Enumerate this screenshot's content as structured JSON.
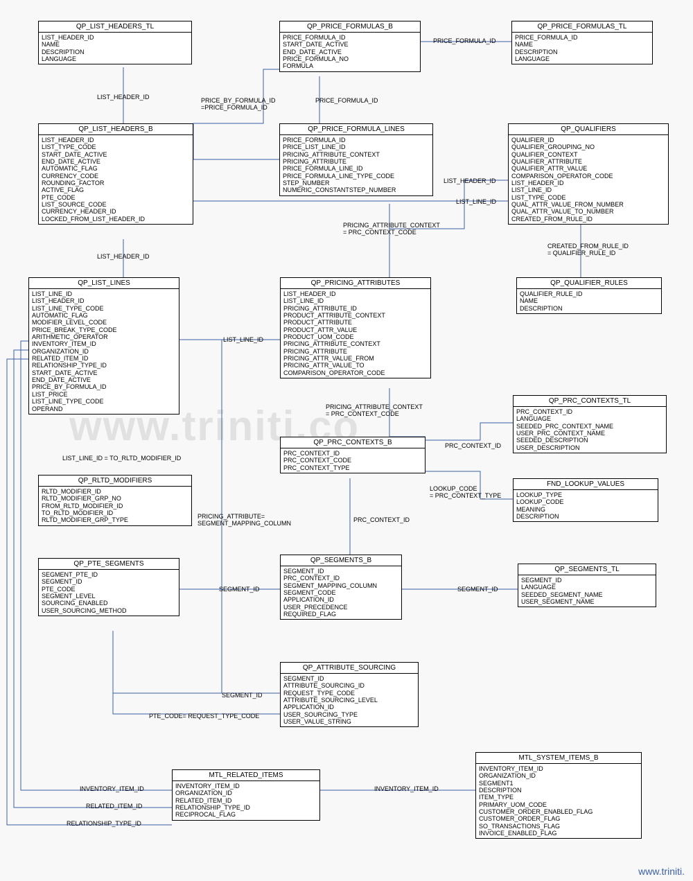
{
  "watermark": "www.triniti.co",
  "footer": "www.triniti.",
  "entities": {
    "qp_list_headers_tl": {
      "title": "QP_LIST_HEADERS_TL",
      "fields": [
        "LIST_HEADER_ID",
        "NAME",
        "DESCRIPTION",
        "LANGUAGE"
      ]
    },
    "qp_price_formulas_b": {
      "title": "QP_PRICE_FORMULAS_B",
      "fields": [
        "PRICE_FORMULA_ID",
        "START_DATE_ACTIVE",
        "END_DATE_ACTIVE",
        "PRICE_FORMULA_NO",
        "FORMULA"
      ]
    },
    "qp_price_formulas_tl": {
      "title": "QP_PRICE_FORMULAS_TL",
      "fields": [
        "PRICE_FORMULA_ID",
        "NAME",
        "DESCRIPTION",
        "LANGUAGE"
      ]
    },
    "qp_list_headers_b": {
      "title": "QP_LIST_HEADERS_B",
      "fields": [
        "LIST_HEADER_ID",
        "LIST_TYPE_CODE",
        "START_DATE_ACTIVE",
        "END_DATE_ACTIVE",
        "AUTOMATIC_FLAG",
        "CURRENCY_CODE",
        "ROUNDING_FACTOR",
        "ACTIVE_FLAG",
        "PTE_CODE",
        "LIST_SOURCE_CODE",
        "CURRENCY_HEADER_ID",
        "LOCKED_FROM_LIST_HEADER_ID"
      ]
    },
    "qp_price_formula_lines": {
      "title": "QP_PRICE_FORMULA_LINES",
      "fields": [
        "PRICE_FORMULA_ID",
        "PRICE_LIST_LINE_ID",
        "PRICING_ATTRIBUTE_CONTEXT",
        "PRICING_ATTRIBUTE",
        "PRICE_FORMULA_LINE_ID",
        "PRICE_FORMULA_LINE_TYPE_CODE",
        "STEP_NUMBER",
        "NUMERIC_CONSTANTSTEP_NUMBER"
      ]
    },
    "qp_qualifiers": {
      "title": "QP_QUALIFIERS",
      "fields": [
        "QUALIFIER_ID",
        "QUALIFIER_GROUPING_NO",
        "QUALIFIER_CONTEXT",
        "QUALIFIER_ATTRIBUTE",
        "QUALIFIER_ATTR_VALUE",
        "COMPARISON_OPERATOR_CODE",
        "LIST_HEADER_ID",
        "LIST_LINE_ID",
        "LIST_TYPE_CODE",
        "QUAL_ATTR_VALUE_FROM_NUMBER",
        "QUAL_ATTR_VALUE_TO_NUMBER",
        "CREATED_FROM_RULE_ID"
      ]
    },
    "qp_list_lines": {
      "title": "QP_LIST_LINES",
      "fields": [
        "LIST_LINE_ID",
        "LIST_HEADER_ID",
        "LIST_LINE_TYPE_CODE",
        "AUTOMATIC_FLAG",
        "MODIFIER_LEVEL_CODE",
        "PRICE_BREAK_TYPE_CODE",
        "ARITHMETIC_OPERATOR",
        "INVENTORY_ITEM_ID",
        "ORGANIZATION_ID",
        "RELATED_ITEM_ID",
        "RELATIONSHIP_TYPE_ID",
        "START_DATE_ACTIVE",
        "END_DATE_ACTIVE",
        "PRICE_BY_FORMULA_ID",
        "LIST_PRICE",
        "LIST_LINE_TYPE_CODE",
        "OPERAND"
      ]
    },
    "qp_pricing_attributes": {
      "title": "QP_PRICING_ATTRIBUTES",
      "fields": [
        "LIST_HEADER_ID",
        "LIST_LINE_ID",
        "PRICING_ATTRIBUTE_ID",
        "PRODUCT_ATTRIBUTE_CONTEXT",
        "PRODUCT_ATTRIBUTE",
        "PRODUCT_ATTR_VALUE",
        "PRODUCT_UOM_CODE",
        "PRICING_ATTRIBUTE_CONTEXT",
        "PRICING_ATTRIBUTE",
        "PRICING_ATTR_VALUE_FROM",
        "PRICING_ATTR_VALUE_TO",
        "COMPARISON_OPERATOR_CODE"
      ]
    },
    "qp_qualifier_rules": {
      "title": "QP_QUALIFIER_RULES",
      "fields": [
        "QUALIFIER_RULE_ID",
        "NAME",
        "DESCRIPTION"
      ]
    },
    "qp_prc_contexts_tl": {
      "title": "QP_PRC_CONTEXTS_TL",
      "fields": [
        "PRC_CONTEXT_ID",
        "LANGUAGE",
        "SEEDED_PRC_CONTEXT_NAME",
        "USER_PRC_CONTEXT_NAME",
        "SEEDED_DESCRIPTION",
        "USER_DESCRIPTION"
      ]
    },
    "qp_prc_contexts_b": {
      "title": "QP_PRC_CONTEXTS_B",
      "fields": [
        "PRC_CONTEXT_ID",
        "PRC_CONTEXT_CODE",
        "PRC_CONTEXT_TYPE"
      ]
    },
    "fnd_lookup_values": {
      "title": "FND_LOOKUP_VALUES",
      "fields": [
        "LOOKUP_TYPE",
        "LOOKUP_CODE",
        "MEANING",
        "DESCRIPTION"
      ]
    },
    "qp_rltd_modifiers": {
      "title": "QP_RLTD_MODIFIERS",
      "fields": [
        "RLTD_MODIFIER_ID",
        "RLTD_MODIFIER_GRP_NO",
        "FROM_RLTD_MODIFIER_ID",
        "TO_RLTD_MODIFIER_ID",
        "RLTD_MODIFIER_GRP_TYPE"
      ]
    },
    "qp_pte_segments": {
      "title": "QP_PTE_SEGMENTS",
      "fields": [
        "SEGMENT_PTE_ID",
        "SEGMENT_ID",
        "PTE_CODE",
        "SEGMENT_LEVEL",
        "SOURCING_ENABLED",
        "USER_SOURCING_METHOD"
      ]
    },
    "qp_segments_b": {
      "title": "QP_SEGMENTS_B",
      "fields": [
        "SEGMENT_ID",
        "PRC_CONTEXT_ID",
        "SEGMENT_MAPPING_COLUMN",
        "SEGMENT_CODE",
        "APPLICATION_ID",
        "USER_PRECEDENCE",
        "REQUIRED_FLAG"
      ]
    },
    "qp_segments_tl": {
      "title": "QP_SEGMENTS_TL",
      "fields": [
        "SEGMENT_ID",
        "LANGUAGE",
        "SEEDED_SEGMENT_NAME",
        "USER_SEGMENT_NAME"
      ]
    },
    "qp_attribute_sourcing": {
      "title": "QP_ATTRIBUTE_SOURCING",
      "fields": [
        "SEGMENT_ID",
        "ATTRIBUTE_SOURCING_ID",
        "REQUEST_TYPE_CODE",
        "ATTRIBUTE_SOURCING_LEVEL",
        "APPLICATION_ID",
        "USER_SOURCING_TYPE",
        "USER_VALUE_STRING"
      ]
    },
    "mtl_related_items": {
      "title": "MTL_RELATED_ITEMS",
      "fields": [
        "INVENTORY_ITEM_ID",
        "ORGANIZATION_ID",
        "RELATED_ITEM_ID",
        "RELATIONSHIP_TYPE_ID",
        "RECIPROCAL_FLAG"
      ]
    },
    "mtl_system_items_b": {
      "title": "MTL_SYSTEM_ITEMS_B",
      "fields": [
        "INVENTORY_ITEM_ID",
        "ORGANIZATION_ID",
        "SEGMENT1",
        "DESCRIPTION",
        "ITEM_TYPE",
        "PRIMARY_UOM_CODE",
        "CUSTOMER_ORDER_ENABLED_FLAG",
        "CUSTOMER_ORDER_FLAG",
        "SO_TRANSACTIONS_FLAG",
        "INVOICE_ENABLED_FLAG"
      ]
    }
  },
  "labels": {
    "list_header_id_1": "LIST_HEADER_ID",
    "price_formula_id_1": "PRICE_FORMULA_ID",
    "price_formula_id_2": "PRICE_FORMULA_ID",
    "price_by_formula": "PRICE_BY_FORMULA_ID\n=PRICE_FORMULA_ID",
    "list_header_id_2": "LIST_HEADER_ID",
    "list_header_id_3": "LIST_HEADER_ID",
    "list_line_id_1": "LIST_LINE_ID",
    "list_line_id_2": "LIST_LINE_ID",
    "list_line_id_to": "LIST_LINE_ID = TO_RLTD_MODIFIER_ID",
    "pricing_attr_ctx_1": "PRICING_ATTRIBUTE_CONTEXT\n= PRC_CONTEXT_CODE",
    "pricing_attr_ctx_2": "PRICING_ATTRIBUTE_CONTEXT\n= PRC_CONTEXT_CODE",
    "created_from_rule": "CREATED_FROM_RULE_ID\n= QUALIFIER_RULE_ID",
    "prc_context_id_1": "PRC_CONTEXT_ID",
    "prc_context_id_2": "PRC_CONTEXT_ID",
    "lookup_code": "LOOKUP_CODE\n= PRC_CONTEXT_TYPE",
    "segment_id_1": "SEGMENT_ID",
    "segment_id_2": "SEGMENT_ID",
    "segment_id_3": "SEGMENT_ID",
    "pricing_attr_seg": "PRICING_ATTRIBUTE=\nSEGMENT_MAPPING_COLUMN",
    "pte_code": "PTE_CODE= REQUEST_TYPE_CODE",
    "inventory_item_id_1": "INVENTORY_ITEM_ID",
    "inventory_item_id_2": "INVENTORY_ITEM_ID",
    "related_item_id": "RELATED_ITEM_ID",
    "relationship_type_id": "RELATIONSHIP_TYPE_ID"
  }
}
